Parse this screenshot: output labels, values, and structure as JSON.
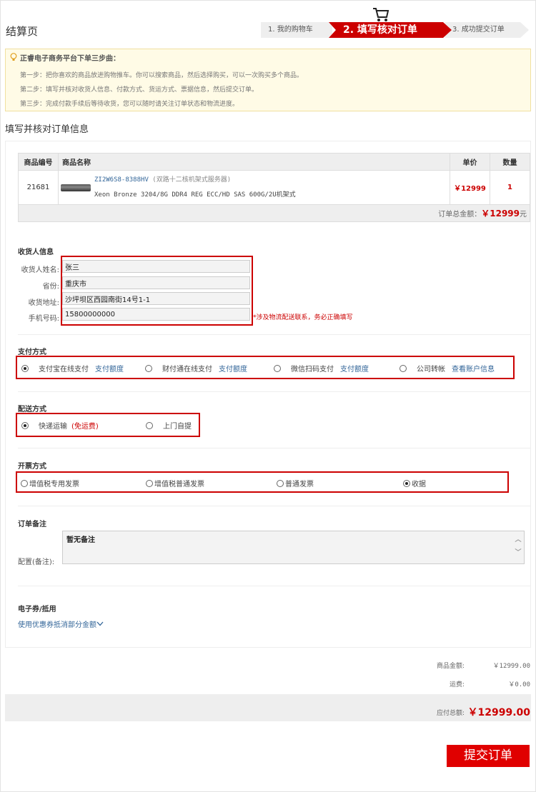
{
  "page": {
    "title": "结算页"
  },
  "steps": [
    "1. 我的购物车",
    "2. 填写核对订单",
    "3. 成功提交订单"
  ],
  "tips": {
    "heading": "正睿电子商务平台下单三步曲：",
    "lines": [
      "第一步：把你喜欢的商品放进购物推车。你可以搜索商品，然后选择购买，可以一次购买多个商品。",
      "第二步：填写并核对收货人信息、付款方式、货运方式、票据信息，然后提交订单。",
      "第三步：完成付款手续后等待收货，您可以随时请关注订单状态和物流进度。"
    ]
  },
  "section_title": "填写并核对订单信息",
  "goods": {
    "headers": {
      "id": "商品编号",
      "name": "商品名称",
      "price": "单价",
      "qty": "数量"
    },
    "rows": [
      {
        "id": "21681",
        "model": "ZI2W6S8-8388HV",
        "model_desc": "(双路十二核机架式服务器)",
        "spec": "Xeon Bronze 3204/8G DDR4 REG ECC/HD SAS 600G/2U机架式",
        "price": "￥12999",
        "qty": "1"
      }
    ],
    "total_label": "订单总金额：",
    "total_value": "￥12999",
    "total_unit": "元"
  },
  "receiver": {
    "title": "收货人信息",
    "name_label": "收货人姓名:",
    "name_value": "张三",
    "province_label": "省份:",
    "province_value": "重庆市",
    "address_label": "收货地址:",
    "address_value": "沙坪坝区西园南街14号1-1",
    "phone_label": "手机号码:",
    "phone_value": "15800000000",
    "hint": "*涉及物流配送联系，务必正确填写"
  },
  "payment": {
    "title": "支付方式",
    "options": [
      {
        "label": "支付宝在线支付",
        "link": "支付额度",
        "selected": true
      },
      {
        "label": "财付通在线支付",
        "link": "支付额度",
        "selected": false
      },
      {
        "label": "微信扫码支付",
        "link": "支付额度",
        "selected": false
      },
      {
        "label": "公司转帐",
        "link": "查看账户信息",
        "selected": false
      }
    ]
  },
  "delivery": {
    "title": "配送方式",
    "options": [
      {
        "label": "快递运输",
        "note": "(免运费)",
        "selected": true
      },
      {
        "label": "上门自提",
        "selected": false
      }
    ]
  },
  "invoice": {
    "title": "开票方式",
    "options": [
      {
        "label": "增值税专用发票",
        "selected": false
      },
      {
        "label": "增值税普通发票",
        "selected": false
      },
      {
        "label": "普通发票",
        "selected": false
      },
      {
        "label": "收据",
        "selected": true
      }
    ]
  },
  "memo": {
    "title": "订单备注",
    "label": "配置(备注):",
    "value": "暂无备注"
  },
  "coupon": {
    "title": "电子券/抵用",
    "link": "使用优惠券抵消部分金额"
  },
  "summary": {
    "goods_label": "商品金额:",
    "goods_value": "￥12999.00",
    "shipping_label": "运费:",
    "shipping_value": "￥0.00",
    "total_label": "应付总额:",
    "total_value": "￥12999.00"
  },
  "submit_label": "提交订单",
  "colors": {
    "accent": "#cc0000",
    "link": "#336699"
  }
}
